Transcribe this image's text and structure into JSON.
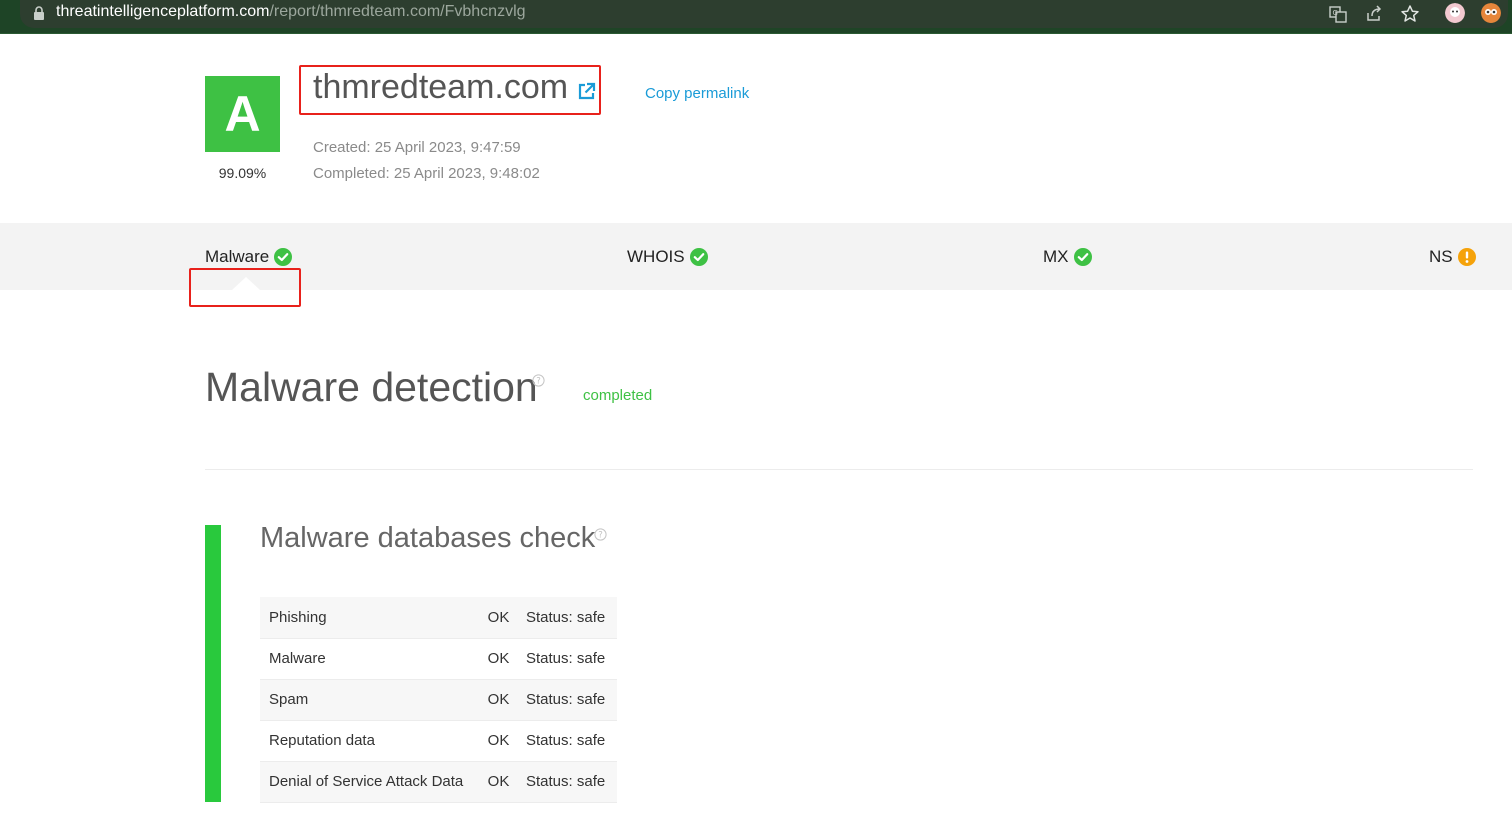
{
  "browser": {
    "url_host": "threatintelligenceplatform.com",
    "url_path": "/report/thmredteam.com/Fvbhcnzvlg"
  },
  "header": {
    "grade": "A",
    "score": "99.09%",
    "domain": "thmredteam.com",
    "copy_permalink": "Copy permalink",
    "created": "Created: 25 April 2023, 9:47:59",
    "completed": "Completed: 25 April 2023, 9:48:02"
  },
  "tabs": [
    {
      "label": "Malware",
      "status_icon": "check-icon"
    },
    {
      "label": "WHOIS",
      "status_icon": "check-icon"
    },
    {
      "label": "MX",
      "status_icon": "check-icon"
    },
    {
      "label": "NS",
      "status_icon": "warning-icon"
    }
  ],
  "section": {
    "title": "Malware detection",
    "status": "completed"
  },
  "malware_check": {
    "title": "Malware databases check",
    "rows": [
      {
        "name": "Phishing",
        "result": "OK",
        "status": "Status: safe"
      },
      {
        "name": "Malware",
        "result": "OK",
        "status": "Status: safe"
      },
      {
        "name": "Spam",
        "result": "OK",
        "status": "Status: safe"
      },
      {
        "name": "Reputation data",
        "result": "OK",
        "status": "Status: safe"
      },
      {
        "name": "Denial of Service Attack Data",
        "result": "OK",
        "status": "Status: safe"
      }
    ]
  },
  "colors": {
    "brand_green": "#3ec144",
    "rail_green": "#29c93d",
    "link_blue": "#1a9bd7",
    "warning_orange": "#f5a20a",
    "highlight_red": "#e8211b"
  }
}
